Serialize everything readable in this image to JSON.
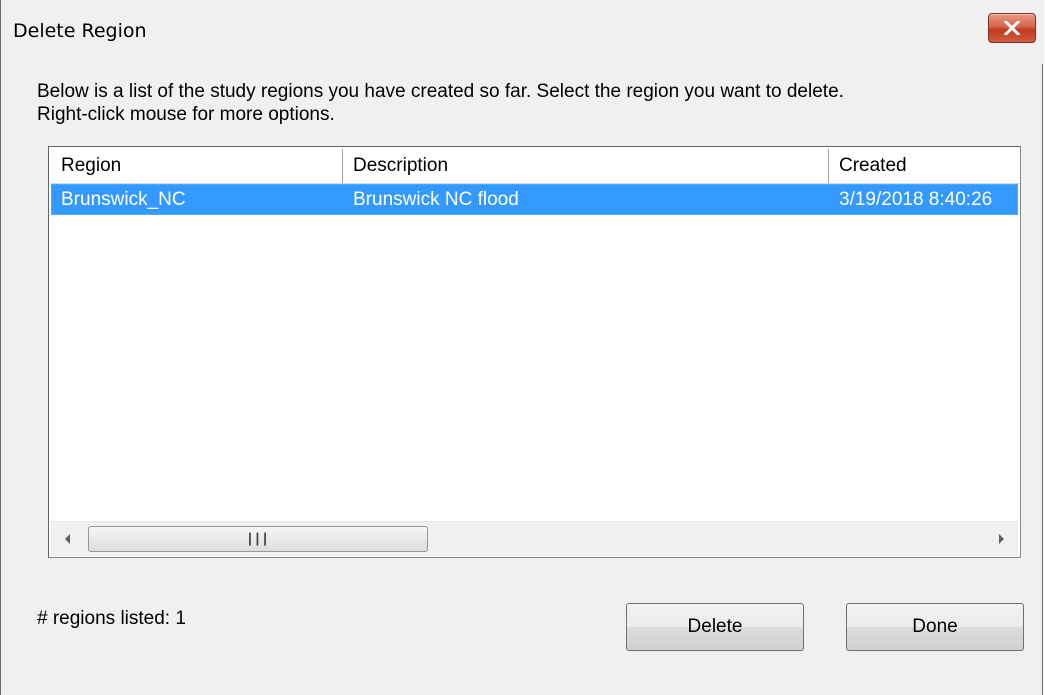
{
  "window": {
    "title": "Delete Region"
  },
  "instructions": {
    "line1": "Below is a list of the study regions you have created so far.  Select the region you want to delete.",
    "line2": "Right-click mouse for more options."
  },
  "table": {
    "columns": [
      "Region",
      "Description",
      "Created"
    ],
    "rows": [
      {
        "region": "Brunswick_NC",
        "description": "Brunswick NC flood",
        "created": "3/19/2018 8:40:26",
        "selected": true
      }
    ]
  },
  "footer": {
    "count_label": "# regions listed: 1",
    "delete_label": "Delete",
    "done_label": "Done"
  },
  "icons": {
    "close": "close-icon",
    "scroll_left": "chevron-left-icon",
    "scroll_right": "chevron-right-icon",
    "scroll_grip": "grip-icon"
  },
  "colors": {
    "selection": "#3399ff",
    "close_button": "#c7432a",
    "dialog_background": "#f0f0f0"
  }
}
